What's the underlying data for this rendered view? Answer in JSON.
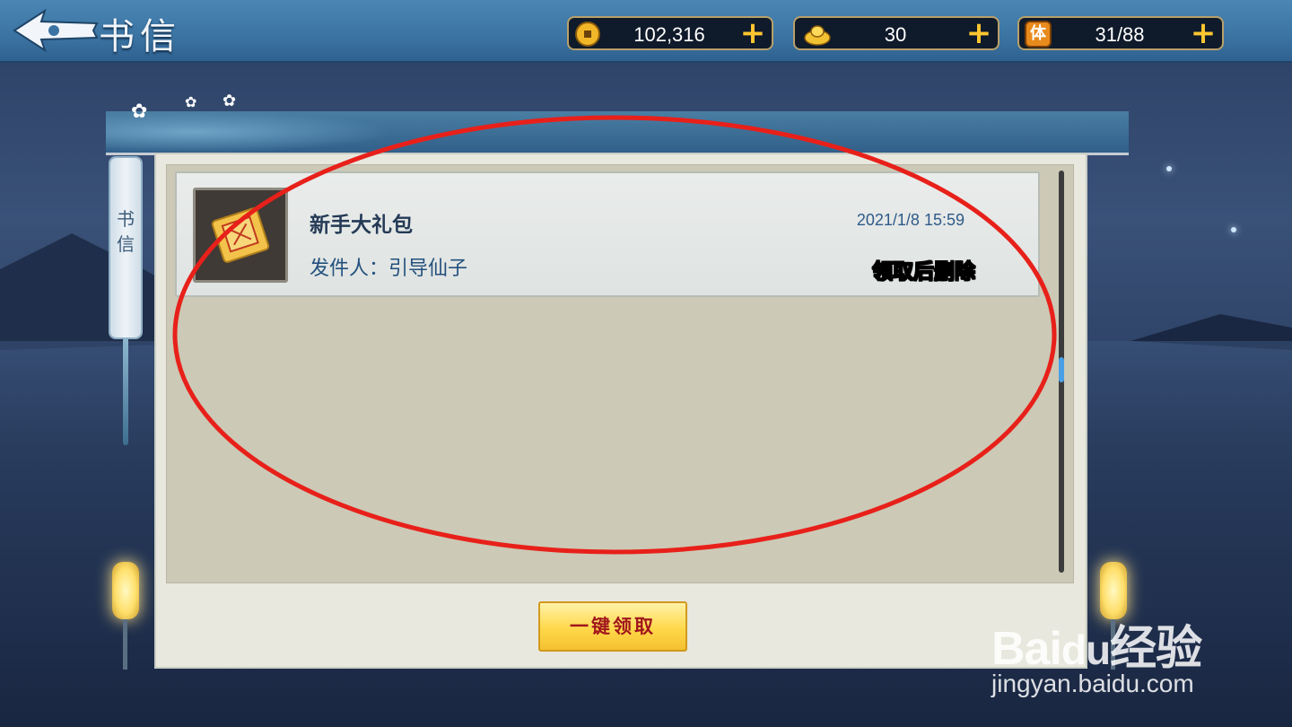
{
  "header": {
    "title": "书信",
    "back_icon": "back-arrow-icon"
  },
  "resources": [
    {
      "icon": "copper-coin-icon",
      "value": "102,316"
    },
    {
      "icon": "gold-ingot-icon",
      "value": "30"
    },
    {
      "icon": "stamina-icon",
      "icon_label": "体",
      "value": "31/88"
    }
  ],
  "sidebar": {
    "tab_label": "书\n信"
  },
  "mail": {
    "items": [
      {
        "title": "新手大礼包",
        "sender": "发件人：引导仙子",
        "time": "2021/1/8 15:59",
        "note": "领取后删除",
        "icon": "gift-scroll-icon"
      }
    ]
  },
  "actions": {
    "claim_all_label": "一键领取"
  },
  "watermark": {
    "logo": "Baidu经验",
    "url": "jingyan.baidu.com"
  },
  "colors": {
    "accent_gold": "#ffc630",
    "annotation_red": "#e8201a",
    "note_yellow": "#ffe512",
    "topbar_blue": "#3b74a3"
  }
}
